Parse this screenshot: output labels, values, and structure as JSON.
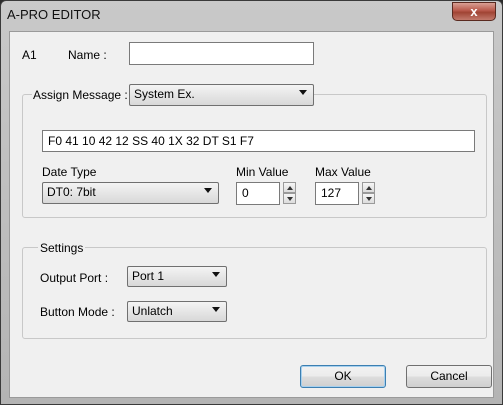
{
  "window": {
    "title": "A-PRO EDITOR",
    "close_glyph": "x"
  },
  "header": {
    "slot_id": "A1",
    "name_label": "Name :",
    "name_value": ""
  },
  "assign": {
    "label": "Assign Message :",
    "selected": "System Ex.",
    "message": "F0 41 10 42 12 SS 40 1X 32 DT S1 F7",
    "data_type_label": "Date Type",
    "data_type_selected": "DT0: 7bit",
    "min_label": "Min Value",
    "min_value": "0",
    "max_label": "Max Value",
    "max_value": "127"
  },
  "settings": {
    "label": "Settings",
    "output_port_label": "Output Port :",
    "output_port_selected": "Port 1",
    "button_mode_label": "Button Mode :",
    "button_mode_selected": "Unlatch"
  },
  "footer": {
    "ok_label": "OK",
    "cancel_label": "Cancel"
  }
}
